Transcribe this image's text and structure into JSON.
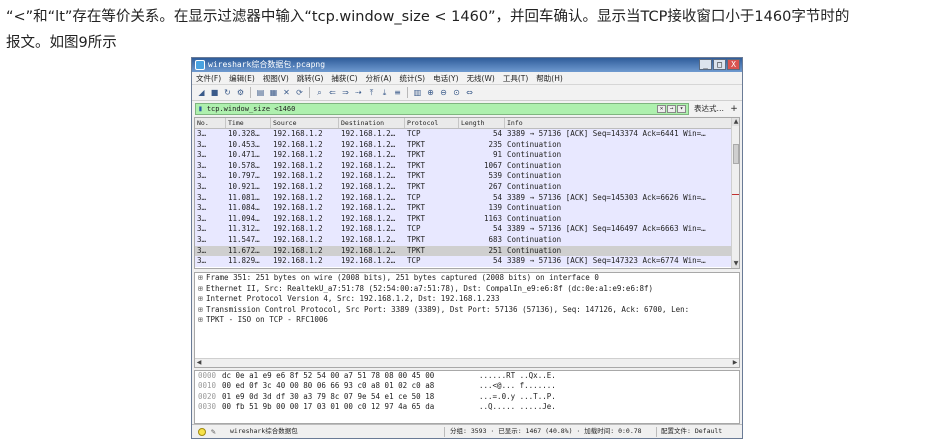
{
  "caption": {
    "line1": "“<”和“lt”存在等价关系。在显示过滤器中输入“tcp.window_size < 1460”，并回车确认。显示当TCP接收窗口小于1460字节时的",
    "line2": "报文。如图9所示"
  },
  "window": {
    "title": "wireshark综合数据包.pcapng",
    "controls": [
      "_",
      "□",
      "X"
    ]
  },
  "menu": [
    "文件(F)",
    "编辑(E)",
    "视图(V)",
    "跳转(G)",
    "捕获(C)",
    "分析(A)",
    "统计(S)",
    "电话(Y)",
    "无线(W)",
    "工具(T)",
    "帮助(H)"
  ],
  "toolbar_icons": [
    "shark-fin-start-icon",
    "stop-icon",
    "restart-icon",
    "options-icon",
    "open-file-icon",
    "save-icon",
    "close-file-icon",
    "reload-icon",
    "find-icon",
    "back-icon",
    "forward-icon",
    "goto-packet-icon",
    "first-packet-icon",
    "last-packet-icon",
    "autoscroll-icon",
    "colorize-icon",
    "zoom-in-icon",
    "zoom-out-icon",
    "zoom-normal-icon",
    "resize-columns-icon"
  ],
  "filter": {
    "value": "tcp.window_size <1460",
    "expression_label": "表达式…",
    "add_label": "+"
  },
  "packet_columns": [
    "No.",
    "Time",
    "Source",
    "Destination",
    "Protocol",
    "Length",
    "Info"
  ],
  "packets": [
    {
      "no": "3…",
      "time": "10.328…",
      "src": "192.168.1.2",
      "dst": "192.168.1.2…",
      "proto": "TCP",
      "len": "54",
      "info": "3389 → 57136 [ACK] Seq=143374 Ack=6441 Win=…"
    },
    {
      "no": "3…",
      "time": "10.453…",
      "src": "192.168.1.2",
      "dst": "192.168.1.2…",
      "proto": "TPKT",
      "len": "235",
      "info": "Continuation"
    },
    {
      "no": "3…",
      "time": "10.471…",
      "src": "192.168.1.2",
      "dst": "192.168.1.2…",
      "proto": "TPKT",
      "len": "91",
      "info": "Continuation"
    },
    {
      "no": "3…",
      "time": "10.578…",
      "src": "192.168.1.2",
      "dst": "192.168.1.2…",
      "proto": "TPKT",
      "len": "1067",
      "info": "Continuation"
    },
    {
      "no": "3…",
      "time": "10.797…",
      "src": "192.168.1.2",
      "dst": "192.168.1.2…",
      "proto": "TPKT",
      "len": "539",
      "info": "Continuation"
    },
    {
      "no": "3…",
      "time": "10.921…",
      "src": "192.168.1.2",
      "dst": "192.168.1.2…",
      "proto": "TPKT",
      "len": "267",
      "info": "Continuation"
    },
    {
      "no": "3…",
      "time": "11.081…",
      "src": "192.168.1.2",
      "dst": "192.168.1.2…",
      "proto": "TCP",
      "len": "54",
      "info": "3389 → 57136 [ACK] Seq=145303 Ack=6626 Win=…"
    },
    {
      "no": "3…",
      "time": "11.084…",
      "src": "192.168.1.2",
      "dst": "192.168.1.2…",
      "proto": "TPKT",
      "len": "139",
      "info": "Continuation"
    },
    {
      "no": "3…",
      "time": "11.094…",
      "src": "192.168.1.2",
      "dst": "192.168.1.2…",
      "proto": "TPKT",
      "len": "1163",
      "info": "Continuation"
    },
    {
      "no": "3…",
      "time": "11.312…",
      "src": "192.168.1.2",
      "dst": "192.168.1.2…",
      "proto": "TCP",
      "len": "54",
      "info": "3389 → 57136 [ACK] Seq=146497 Ack=6663 Win=…"
    },
    {
      "no": "3…",
      "time": "11.547…",
      "src": "192.168.1.2",
      "dst": "192.168.1.2…",
      "proto": "TPKT",
      "len": "683",
      "info": "Continuation"
    },
    {
      "no": "3…",
      "time": "11.672…",
      "src": "192.168.1.2",
      "dst": "192.168.1.2…",
      "proto": "TPKT",
      "len": "251",
      "info": "Continuation",
      "selected": true
    },
    {
      "no": "3…",
      "time": "11.829…",
      "src": "192.168.1.2",
      "dst": "192.168.1.2…",
      "proto": "TCP",
      "len": "54",
      "info": "3389 → 57136 [ACK] Seq=147323 Ack=6774 Win=…"
    }
  ],
  "details": [
    "Frame 351: 251 bytes on wire (2008 bits), 251 bytes captured (2008 bits) on interface 0",
    "Ethernet II, Src: RealtekU_a7:51:78 (52:54:00:a7:51:78), Dst: CompalIn_e9:e6:8f (dc:0e:a1:e9:e6:8f)",
    "Internet Protocol Version 4, Src: 192.168.1.2, Dst: 192.168.1.233",
    "Transmission Control Protocol, Src Port: 3389 (3389), Dst Port: 57136 (57136), Seq: 147126, Ack: 6700, Len:",
    "TPKT - ISO on TCP - RFC1006"
  ],
  "bytes": [
    {
      "off": "0000",
      "hex": "dc 0e a1 e9 e6 8f 52 54  00 a7 51 78 08 00 45 00",
      "ascii": "......RT ..Qx..E."
    },
    {
      "off": "0010",
      "hex": "00 ed 0f 3c 40 00 80 06  66 93 c0 a8 01 02 c0 a8",
      "ascii": "...<@... f......."
    },
    {
      "off": "0020",
      "hex": "01 e9 0d 3d df 30 a3 79  8c 07 9e 54 e1 ce 50 18",
      "ascii": "...=.0.y ...T..P."
    },
    {
      "off": "0030",
      "hex": "00 fb 51 9b 00 00 17 03  01 00 c0 12 97 4a 65 da",
      "ascii": "..Q..... .....Je."
    }
  ],
  "status": {
    "file": "wireshark综合数据包",
    "stats": "分组: 3593 · 已显示: 1467 (40.8%) · 加载时间: 0:0.78",
    "profile": "配置文件: Default"
  }
}
